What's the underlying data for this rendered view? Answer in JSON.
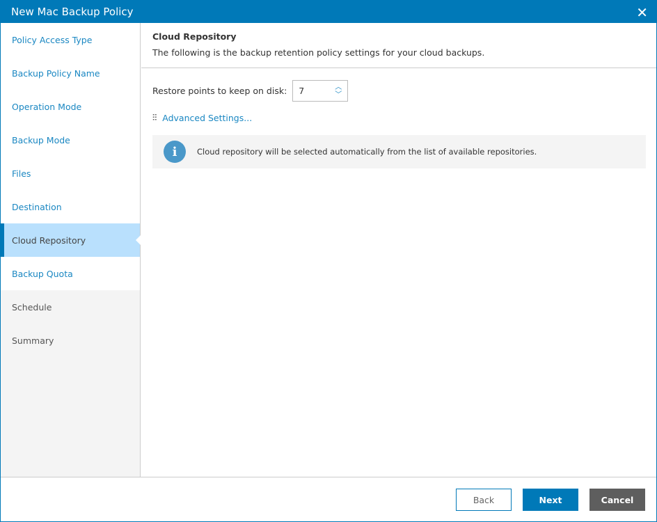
{
  "title": "New Mac Backup Policy",
  "steps": [
    {
      "label": "Policy Access Type",
      "state": "done"
    },
    {
      "label": "Backup Policy Name",
      "state": "done"
    },
    {
      "label": "Operation Mode",
      "state": "done"
    },
    {
      "label": "Backup Mode",
      "state": "done"
    },
    {
      "label": "Files",
      "state": "done"
    },
    {
      "label": "Destination",
      "state": "done"
    },
    {
      "label": "Cloud Repository",
      "state": "active"
    },
    {
      "label": "Backup Quota",
      "state": "done"
    },
    {
      "label": "Schedule",
      "state": "pending"
    },
    {
      "label": "Summary",
      "state": "pending"
    }
  ],
  "header": {
    "title": "Cloud Repository",
    "subtitle": "The following is the backup retention policy settings for your cloud backups."
  },
  "restore": {
    "label": "Restore points to keep on disk:",
    "value": "7"
  },
  "advanced": "Advanced Settings...",
  "info": "Cloud repository will be selected automatically from the list of available repositories.",
  "buttons": {
    "back": "Back",
    "next": "Next",
    "cancel": "Cancel"
  }
}
